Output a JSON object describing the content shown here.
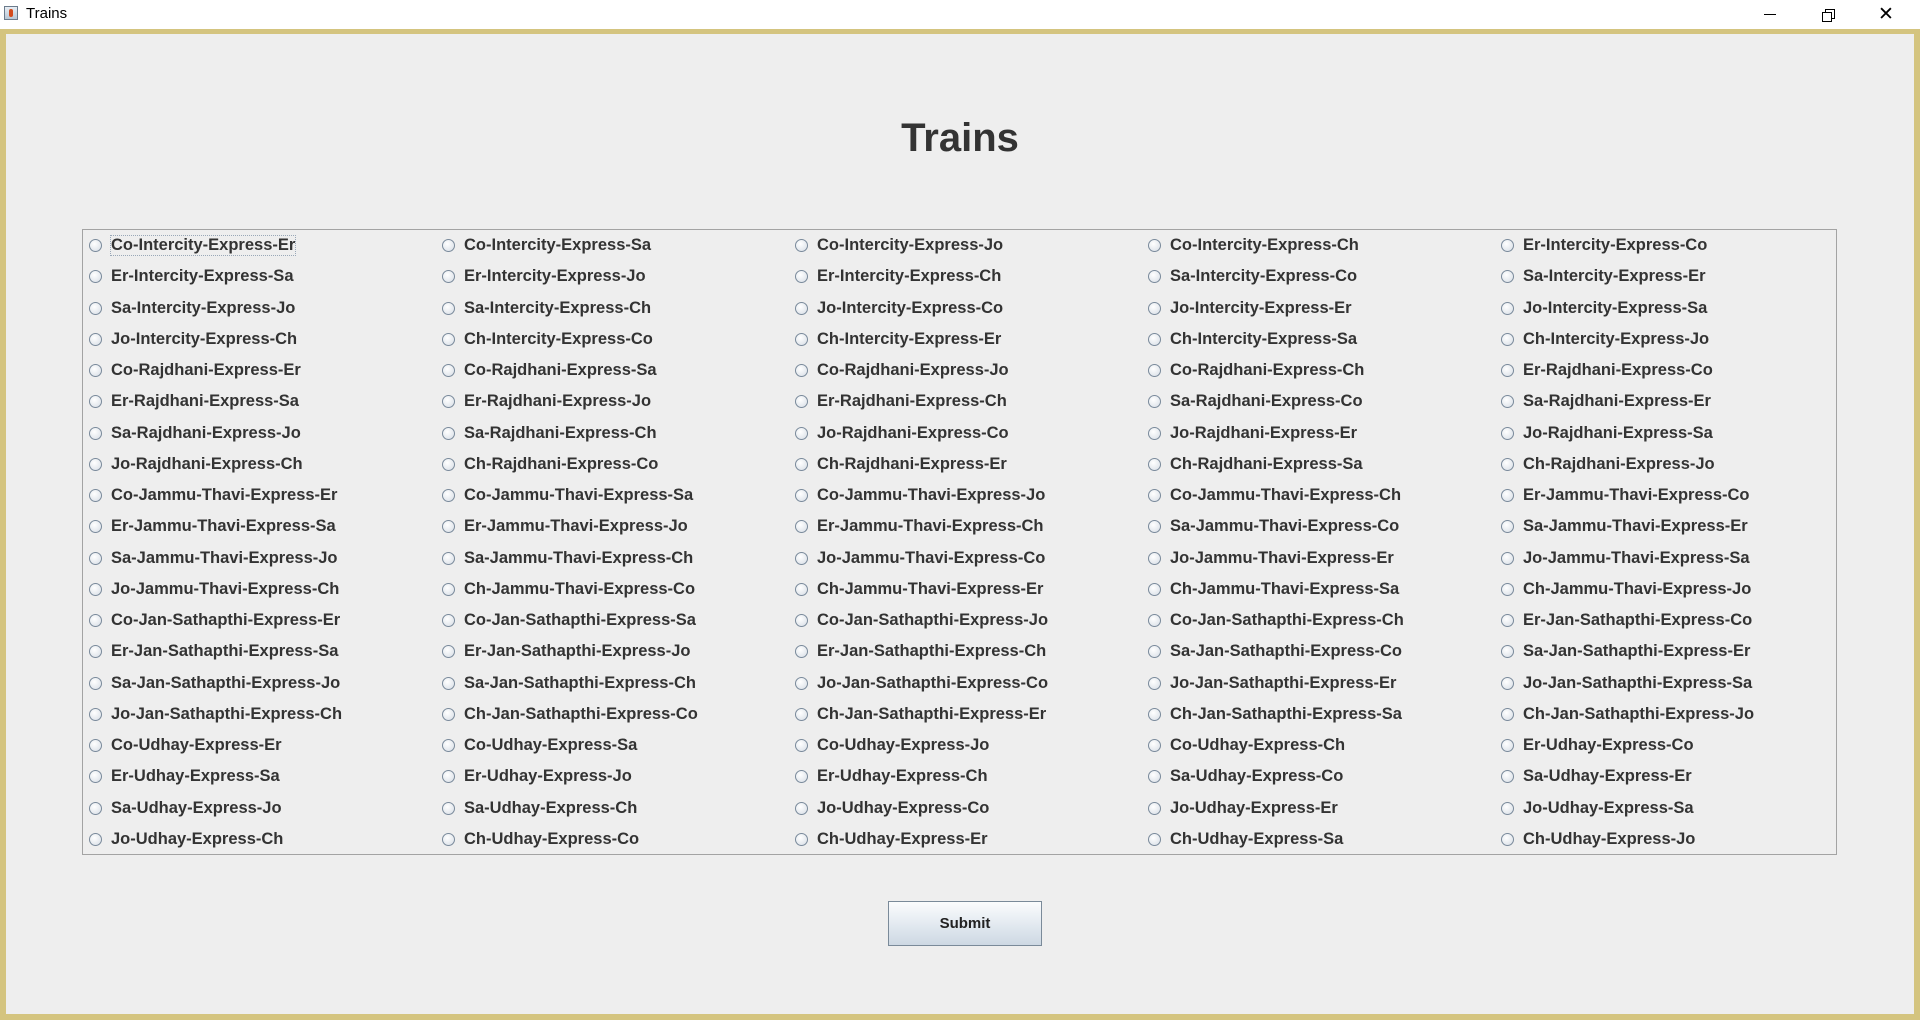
{
  "window": {
    "title": "Trains"
  },
  "heading": "Trains",
  "trains": [
    "Co-Intercity-Express-Er",
    "Co-Intercity-Express-Sa",
    "Co-Intercity-Express-Jo",
    "Co-Intercity-Express-Ch",
    "Er-Intercity-Express-Co",
    "Er-Intercity-Express-Sa",
    "Er-Intercity-Express-Jo",
    "Er-Intercity-Express-Ch",
    "Sa-Intercity-Express-Co",
    "Sa-Intercity-Express-Er",
    "Sa-Intercity-Express-Jo",
    "Sa-Intercity-Express-Ch",
    "Jo-Intercity-Express-Co",
    "Jo-Intercity-Express-Er",
    "Jo-Intercity-Express-Sa",
    "Jo-Intercity-Express-Ch",
    "Ch-Intercity-Express-Co",
    "Ch-Intercity-Express-Er",
    "Ch-Intercity-Express-Sa",
    "Ch-Intercity-Express-Jo",
    "Co-Rajdhani-Express-Er",
    "Co-Rajdhani-Express-Sa",
    "Co-Rajdhani-Express-Jo",
    "Co-Rajdhani-Express-Ch",
    "Er-Rajdhani-Express-Co",
    "Er-Rajdhani-Express-Sa",
    "Er-Rajdhani-Express-Jo",
    "Er-Rajdhani-Express-Ch",
    "Sa-Rajdhani-Express-Co",
    "Sa-Rajdhani-Express-Er",
    "Sa-Rajdhani-Express-Jo",
    "Sa-Rajdhani-Express-Ch",
    "Jo-Rajdhani-Express-Co",
    "Jo-Rajdhani-Express-Er",
    "Jo-Rajdhani-Express-Sa",
    "Jo-Rajdhani-Express-Ch",
    "Ch-Rajdhani-Express-Co",
    "Ch-Rajdhani-Express-Er",
    "Ch-Rajdhani-Express-Sa",
    "Ch-Rajdhani-Express-Jo",
    "Co-Jammu-Thavi-Express-Er",
    "Co-Jammu-Thavi-Express-Sa",
    "Co-Jammu-Thavi-Express-Jo",
    "Co-Jammu-Thavi-Express-Ch",
    "Er-Jammu-Thavi-Express-Co",
    "Er-Jammu-Thavi-Express-Sa",
    "Er-Jammu-Thavi-Express-Jo",
    "Er-Jammu-Thavi-Express-Ch",
    "Sa-Jammu-Thavi-Express-Co",
    "Sa-Jammu-Thavi-Express-Er",
    "Sa-Jammu-Thavi-Express-Jo",
    "Sa-Jammu-Thavi-Express-Ch",
    "Jo-Jammu-Thavi-Express-Co",
    "Jo-Jammu-Thavi-Express-Er",
    "Jo-Jammu-Thavi-Express-Sa",
    "Jo-Jammu-Thavi-Express-Ch",
    "Ch-Jammu-Thavi-Express-Co",
    "Ch-Jammu-Thavi-Express-Er",
    "Ch-Jammu-Thavi-Express-Sa",
    "Ch-Jammu-Thavi-Express-Jo",
    "Co-Jan-Sathapthi-Express-Er",
    "Co-Jan-Sathapthi-Express-Sa",
    "Co-Jan-Sathapthi-Express-Jo",
    "Co-Jan-Sathapthi-Express-Ch",
    "Er-Jan-Sathapthi-Express-Co",
    "Er-Jan-Sathapthi-Express-Sa",
    "Er-Jan-Sathapthi-Express-Jo",
    "Er-Jan-Sathapthi-Express-Ch",
    "Sa-Jan-Sathapthi-Express-Co",
    "Sa-Jan-Sathapthi-Express-Er",
    "Sa-Jan-Sathapthi-Express-Jo",
    "Sa-Jan-Sathapthi-Express-Ch",
    "Jo-Jan-Sathapthi-Express-Co",
    "Jo-Jan-Sathapthi-Express-Er",
    "Jo-Jan-Sathapthi-Express-Sa",
    "Jo-Jan-Sathapthi-Express-Ch",
    "Ch-Jan-Sathapthi-Express-Co",
    "Ch-Jan-Sathapthi-Express-Er",
    "Ch-Jan-Sathapthi-Express-Sa",
    "Ch-Jan-Sathapthi-Express-Jo",
    "Co-Udhay-Express-Er",
    "Co-Udhay-Express-Sa",
    "Co-Udhay-Express-Jo",
    "Co-Udhay-Express-Ch",
    "Er-Udhay-Express-Co",
    "Er-Udhay-Express-Sa",
    "Er-Udhay-Express-Jo",
    "Er-Udhay-Express-Ch",
    "Sa-Udhay-Express-Co",
    "Sa-Udhay-Express-Er",
    "Sa-Udhay-Express-Jo",
    "Sa-Udhay-Express-Ch",
    "Jo-Udhay-Express-Co",
    "Jo-Udhay-Express-Er",
    "Jo-Udhay-Express-Sa",
    "Jo-Udhay-Express-Ch",
    "Ch-Udhay-Express-Co",
    "Ch-Udhay-Express-Er",
    "Ch-Udhay-Express-Sa",
    "Ch-Udhay-Express-Jo"
  ],
  "focused_index": 0,
  "submit_label": "Submit"
}
